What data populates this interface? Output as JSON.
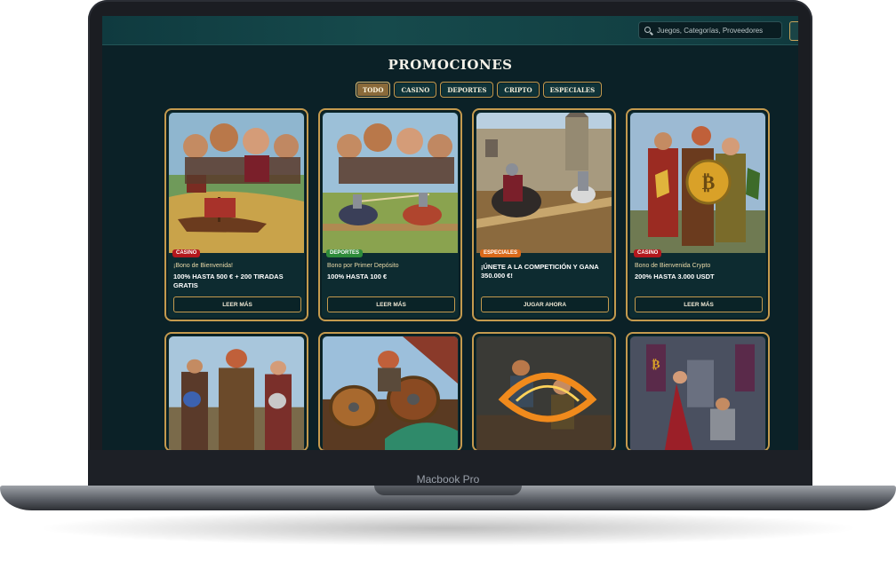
{
  "device": {
    "model_label": "Macbook Pro"
  },
  "header": {
    "search": {
      "placeholder": "Juegos, Categorías, Proveedores"
    }
  },
  "page": {
    "title": "PROMOCIONES",
    "tabs": [
      {
        "label": "TODO",
        "active": true
      },
      {
        "label": "CASINO",
        "active": false
      },
      {
        "label": "DEPORTES",
        "active": false
      },
      {
        "label": "CRIPTO",
        "active": false
      },
      {
        "label": "ESPECIALES",
        "active": false
      }
    ]
  },
  "promotions": [
    {
      "badge": "CASINO",
      "badge_color": "#b3171d",
      "subtitle": "¡Bono de Bienvenida!",
      "title": "100% HASTA 500 € + 200 TIRADAS GRATIS",
      "button": "LEER MÁS",
      "art": "vikings-ship"
    },
    {
      "badge": "DEPORTES",
      "badge_color": "#2e8b3a",
      "subtitle": "Bono por Primer Depósito",
      "title": "100% HASTA 100 €",
      "button": "LEER MÁS",
      "art": "joust"
    },
    {
      "badge": "ESPECIALES",
      "badge_color": "#d9691a",
      "subtitle": "",
      "title": "¡ÚNETE A LA COMPETICIÓN Y GANA 350.000 €!",
      "button": "JUGAR AHORA",
      "art": "castle-knights"
    },
    {
      "badge": "CASINO",
      "badge_color": "#b3171d",
      "subtitle": "Bono de Bienvenida Crypto",
      "title": "200% HASTA 3.000 USDT",
      "button": "LEER MÁS",
      "art": "crypto-shields"
    },
    {
      "art": "trophy-heroes"
    },
    {
      "art": "viking-shields"
    },
    {
      "art": "fire-duel"
    },
    {
      "art": "throne-hall"
    }
  ],
  "colors": {
    "gold": "#c49a4e",
    "background": "#0b2127"
  }
}
